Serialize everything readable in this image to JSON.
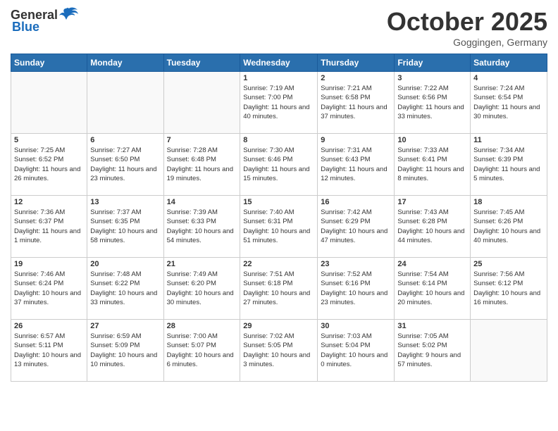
{
  "header": {
    "logo_general": "General",
    "logo_blue": "Blue",
    "month": "October 2025",
    "location": "Goggingen, Germany"
  },
  "days_of_week": [
    "Sunday",
    "Monday",
    "Tuesday",
    "Wednesday",
    "Thursday",
    "Friday",
    "Saturday"
  ],
  "weeks": [
    [
      {
        "day": "",
        "info": ""
      },
      {
        "day": "",
        "info": ""
      },
      {
        "day": "",
        "info": ""
      },
      {
        "day": "1",
        "info": "Sunrise: 7:19 AM\nSunset: 7:00 PM\nDaylight: 11 hours and 40 minutes."
      },
      {
        "day": "2",
        "info": "Sunrise: 7:21 AM\nSunset: 6:58 PM\nDaylight: 11 hours and 37 minutes."
      },
      {
        "day": "3",
        "info": "Sunrise: 7:22 AM\nSunset: 6:56 PM\nDaylight: 11 hours and 33 minutes."
      },
      {
        "day": "4",
        "info": "Sunrise: 7:24 AM\nSunset: 6:54 PM\nDaylight: 11 hours and 30 minutes."
      }
    ],
    [
      {
        "day": "5",
        "info": "Sunrise: 7:25 AM\nSunset: 6:52 PM\nDaylight: 11 hours and 26 minutes."
      },
      {
        "day": "6",
        "info": "Sunrise: 7:27 AM\nSunset: 6:50 PM\nDaylight: 11 hours and 23 minutes."
      },
      {
        "day": "7",
        "info": "Sunrise: 7:28 AM\nSunset: 6:48 PM\nDaylight: 11 hours and 19 minutes."
      },
      {
        "day": "8",
        "info": "Sunrise: 7:30 AM\nSunset: 6:46 PM\nDaylight: 11 hours and 15 minutes."
      },
      {
        "day": "9",
        "info": "Sunrise: 7:31 AM\nSunset: 6:43 PM\nDaylight: 11 hours and 12 minutes."
      },
      {
        "day": "10",
        "info": "Sunrise: 7:33 AM\nSunset: 6:41 PM\nDaylight: 11 hours and 8 minutes."
      },
      {
        "day": "11",
        "info": "Sunrise: 7:34 AM\nSunset: 6:39 PM\nDaylight: 11 hours and 5 minutes."
      }
    ],
    [
      {
        "day": "12",
        "info": "Sunrise: 7:36 AM\nSunset: 6:37 PM\nDaylight: 11 hours and 1 minute."
      },
      {
        "day": "13",
        "info": "Sunrise: 7:37 AM\nSunset: 6:35 PM\nDaylight: 10 hours and 58 minutes."
      },
      {
        "day": "14",
        "info": "Sunrise: 7:39 AM\nSunset: 6:33 PM\nDaylight: 10 hours and 54 minutes."
      },
      {
        "day": "15",
        "info": "Sunrise: 7:40 AM\nSunset: 6:31 PM\nDaylight: 10 hours and 51 minutes."
      },
      {
        "day": "16",
        "info": "Sunrise: 7:42 AM\nSunset: 6:29 PM\nDaylight: 10 hours and 47 minutes."
      },
      {
        "day": "17",
        "info": "Sunrise: 7:43 AM\nSunset: 6:28 PM\nDaylight: 10 hours and 44 minutes."
      },
      {
        "day": "18",
        "info": "Sunrise: 7:45 AM\nSunset: 6:26 PM\nDaylight: 10 hours and 40 minutes."
      }
    ],
    [
      {
        "day": "19",
        "info": "Sunrise: 7:46 AM\nSunset: 6:24 PM\nDaylight: 10 hours and 37 minutes."
      },
      {
        "day": "20",
        "info": "Sunrise: 7:48 AM\nSunset: 6:22 PM\nDaylight: 10 hours and 33 minutes."
      },
      {
        "day": "21",
        "info": "Sunrise: 7:49 AM\nSunset: 6:20 PM\nDaylight: 10 hours and 30 minutes."
      },
      {
        "day": "22",
        "info": "Sunrise: 7:51 AM\nSunset: 6:18 PM\nDaylight: 10 hours and 27 minutes."
      },
      {
        "day": "23",
        "info": "Sunrise: 7:52 AM\nSunset: 6:16 PM\nDaylight: 10 hours and 23 minutes."
      },
      {
        "day": "24",
        "info": "Sunrise: 7:54 AM\nSunset: 6:14 PM\nDaylight: 10 hours and 20 minutes."
      },
      {
        "day": "25",
        "info": "Sunrise: 7:56 AM\nSunset: 6:12 PM\nDaylight: 10 hours and 16 minutes."
      }
    ],
    [
      {
        "day": "26",
        "info": "Sunrise: 6:57 AM\nSunset: 5:11 PM\nDaylight: 10 hours and 13 minutes."
      },
      {
        "day": "27",
        "info": "Sunrise: 6:59 AM\nSunset: 5:09 PM\nDaylight: 10 hours and 10 minutes."
      },
      {
        "day": "28",
        "info": "Sunrise: 7:00 AM\nSunset: 5:07 PM\nDaylight: 10 hours and 6 minutes."
      },
      {
        "day": "29",
        "info": "Sunrise: 7:02 AM\nSunset: 5:05 PM\nDaylight: 10 hours and 3 minutes."
      },
      {
        "day": "30",
        "info": "Sunrise: 7:03 AM\nSunset: 5:04 PM\nDaylight: 10 hours and 0 minutes."
      },
      {
        "day": "31",
        "info": "Sunrise: 7:05 AM\nSunset: 5:02 PM\nDaylight: 9 hours and 57 minutes."
      },
      {
        "day": "",
        "info": ""
      }
    ]
  ]
}
